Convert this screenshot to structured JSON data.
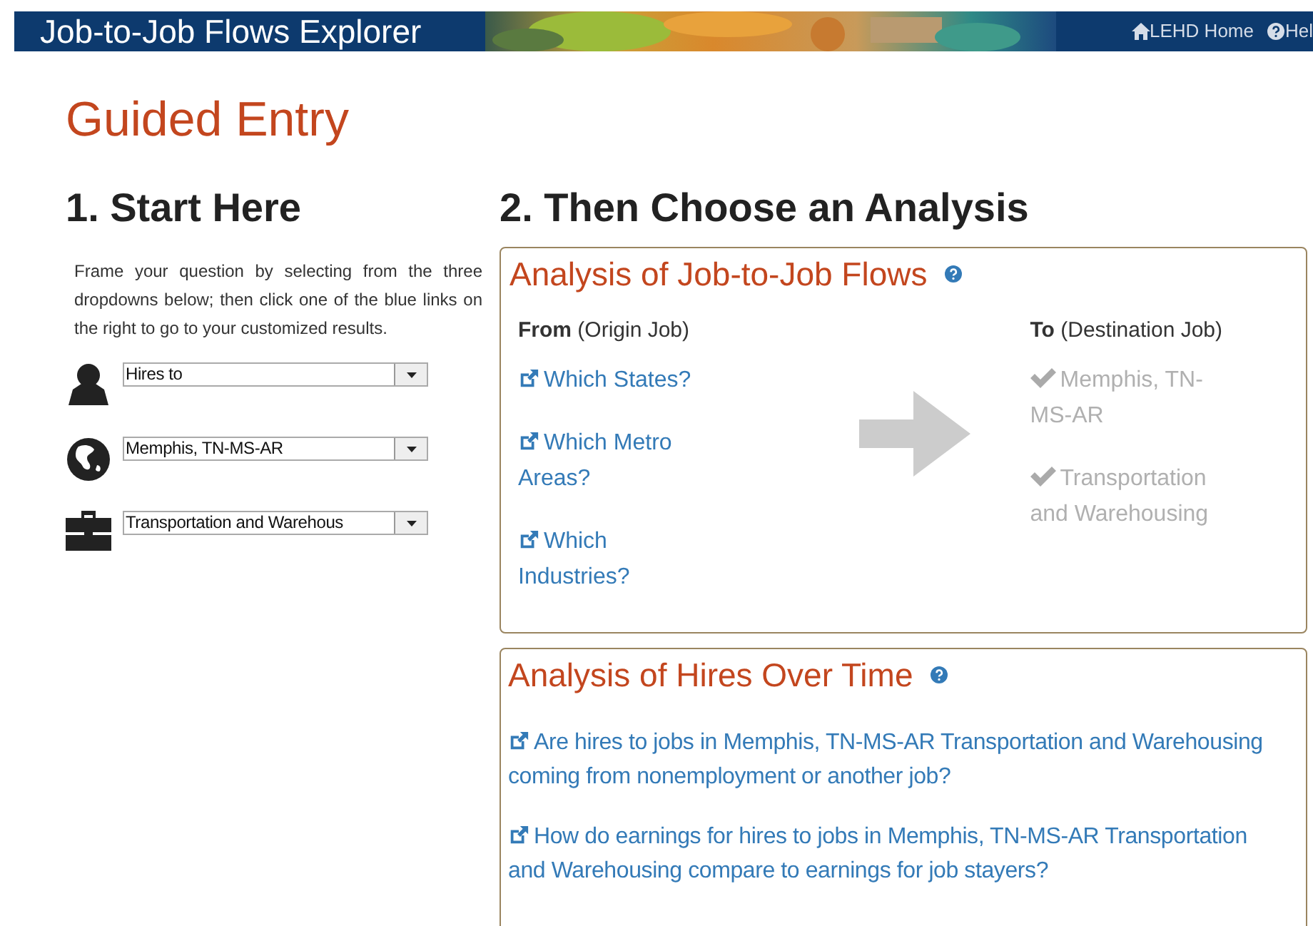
{
  "header": {
    "title": "Job-to-Job Flows Explorer",
    "links": [
      "LEHD Home",
      "Hel"
    ]
  },
  "page_title": "Guided Entry",
  "start": {
    "heading": "1. Start Here",
    "intro": "Frame your question by selecting from the three dropdowns below; then click one of the blue links on the right to go to your customized results.",
    "dropdowns": [
      {
        "value": "Hires to"
      },
      {
        "value": "Memphis, TN-MS-AR"
      },
      {
        "value": "Transportation and Warehous"
      }
    ]
  },
  "analysis": {
    "heading": "2. Then Choose an Analysis",
    "flows": {
      "title": "Analysis of Job-to-Job Flows",
      "from_label": "**From** (Origin Job)",
      "to_label": "**To** (Destination Job)",
      "from_links": [
        "Which States?",
        "Which Metro Areas?",
        "Which Industries?"
      ],
      "to_items": [
        {
          "text": "Memphis, TN-MS-AR",
          "checked": true
        },
        {
          "text": "Transportation and Warehousing",
          "checked": true
        }
      ]
    },
    "hires": {
      "title": "Analysis of Hires Over Time",
      "links": [
        "Are hires to jobs in Memphis, TN-MS-AR Transportation and Warehousing coming from nonemployment or another job?",
        "How do earnings for hires to jobs in Memphis, TN-MS-AR Transportation and Warehousing compare to earnings for job stayers?"
      ]
    }
  }
}
